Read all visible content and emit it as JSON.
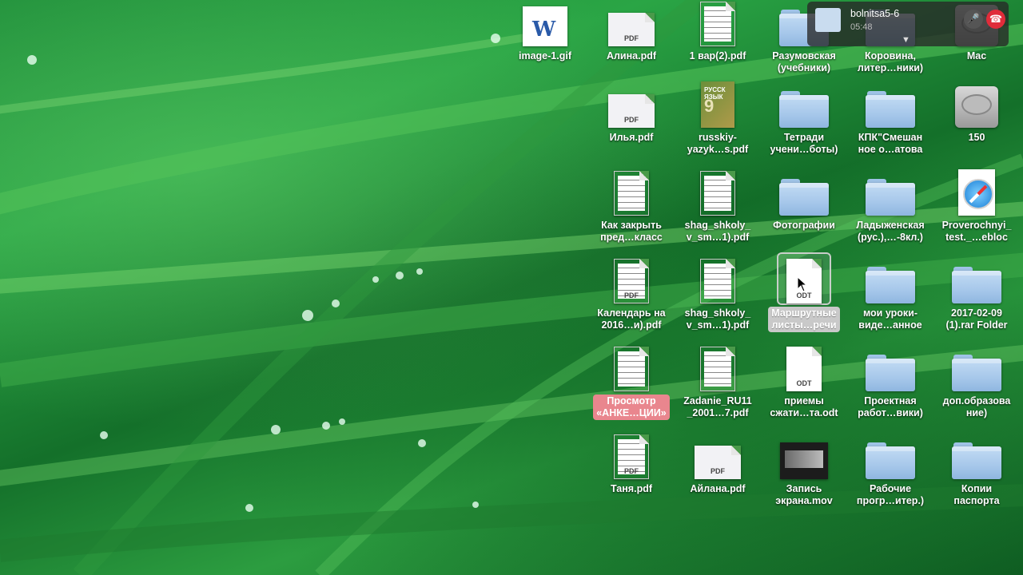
{
  "desktop": {
    "icons": [
      {
        "label": "image-1.gif",
        "kind": "word"
      },
      {
        "label": "Алина.pdf",
        "kind": "pdf-wide"
      },
      {
        "label": "1 вар(2).pdf",
        "kind": "doc-lines"
      },
      {
        "label": "Разумовская\n(учебники)",
        "kind": "folder"
      },
      {
        "label": "Коровина,\nлитер…ники)",
        "kind": "folder"
      },
      {
        "label": "Mac",
        "kind": "disk"
      },
      {
        "label": "Илья.pdf",
        "kind": "pdf-wide"
      },
      {
        "label": "russkiy-\nyazyk…s.pdf",
        "kind": "book"
      },
      {
        "label": "Тетради\nучени…боты)",
        "kind": "folder"
      },
      {
        "label": "КПК\"Смешан\nное о…атова",
        "kind": "folder"
      },
      {
        "label": "150",
        "kind": "disk"
      },
      {
        "label": "Как закрыть\nпред…класс",
        "kind": "doc-lines"
      },
      {
        "label": "shag_shkoly_\nv_sm…1).pdf",
        "kind": "doc-lines"
      },
      {
        "label": "Фотографии",
        "kind": "folder"
      },
      {
        "label": "Ладыженская\n(рус.),…-8кл.)",
        "kind": "folder"
      },
      {
        "label": "Proverochnyi_\ntest._…ebloc",
        "kind": "safari"
      },
      {
        "label": "Календарь на\n2016…и).pdf",
        "kind": "pdf"
      },
      {
        "label": "shag_shkoly_\nv_sm…1).pdf",
        "kind": "doc-lines"
      },
      {
        "label": "Маршрутные\nлисты…речи",
        "kind": "odt",
        "selected": "grey"
      },
      {
        "label": "мои уроки-\nвиде…анное",
        "kind": "folder"
      },
      {
        "label": "2017-02-09\n(1).rar Folder",
        "kind": "folder"
      },
      {
        "label": "Просмотр\n«АНКЕ…ЦИИ»",
        "kind": "doc-lines",
        "selected": "red"
      },
      {
        "label": "Zadanie_RU11\n_2001…7.pdf",
        "kind": "doc-lines"
      },
      {
        "label": "приемы\nсжати…та.odt",
        "kind": "odt"
      },
      {
        "label": "Проектная\nработ…вики)",
        "kind": "folder"
      },
      {
        "label": "доп.образова\nние)",
        "kind": "folder"
      },
      {
        "label": "Таня.pdf",
        "kind": "pdf"
      },
      {
        "label": "Айлана.pdf",
        "kind": "pdf-wide"
      },
      {
        "label": "Запись\nэкрана.mov",
        "kind": "movie"
      },
      {
        "label": "Рабочие\nпрогр…итер.)",
        "kind": "folder"
      },
      {
        "label": "Копии\nпаспорта",
        "kind": "folder"
      }
    ],
    "file_tags": {
      "pdf": "PDF",
      "odt": "ODT"
    }
  },
  "call_notification": {
    "name": "bolnitsa5-6",
    "duration": "05:48",
    "mute_icon": "microphone-icon",
    "hangup_icon": "hang-up-icon",
    "hangup_color": "#e02c3a"
  }
}
